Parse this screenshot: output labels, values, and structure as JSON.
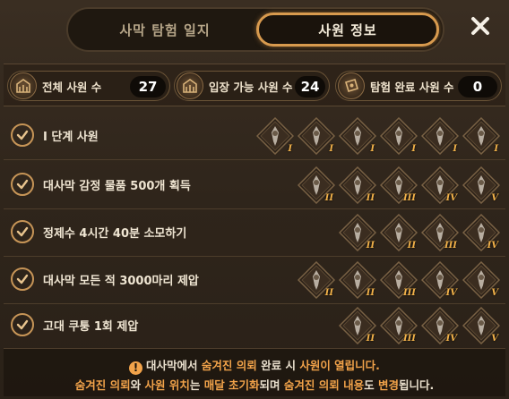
{
  "tabs": {
    "inactive_label": "사막 탐험 일지",
    "active_label": "사원 정보"
  },
  "stats": {
    "total_label": "전체 사원 수",
    "total_value": "27",
    "enterable_label": "입장 가능 사원 수",
    "enterable_value": "24",
    "completed_label": "탐험 완료 사원 수",
    "completed_value": "0"
  },
  "rows": [
    {
      "label": "Ⅰ 단계 사원",
      "badges": [
        "I",
        "I",
        "I",
        "I",
        "I",
        "I"
      ]
    },
    {
      "label": "대사막 감정 물품 500개 획득",
      "badges": [
        "II",
        "II",
        "III",
        "IV",
        "V"
      ]
    },
    {
      "label": "정제수 4시간 40분 소모하기",
      "badges": [
        "II",
        "II",
        "III",
        "IV"
      ]
    },
    {
      "label": "대사막 모든 적 3000마리 제압",
      "badges": [
        "II",
        "II",
        "III",
        "IV",
        "V"
      ]
    },
    {
      "label": "고대 쿠퉁 1회 제압",
      "badges": [
        "II",
        "III",
        "IV",
        "V"
      ]
    }
  ],
  "notice": {
    "l1_a": "대사막에서 ",
    "l1_b": "숨겨진 의뢰",
    "l1_c": " 완료 시 ",
    "l1_d": "사원이 열립니다.",
    "l2_a": "숨겨진 의뢰",
    "l2_b": "와 ",
    "l2_c": "사원 위치",
    "l2_d": "는 ",
    "l2_e": "매달 초기화",
    "l2_f": "되며 ",
    "l2_g": "숨겨진 의뢰 내용",
    "l2_h": "도 ",
    "l2_i": "변경",
    "l2_j": "됩니다."
  },
  "colors": {
    "accent": "#d89a4e",
    "highlight": "#f2a34a",
    "badge_numeral": "#f2b24a"
  }
}
